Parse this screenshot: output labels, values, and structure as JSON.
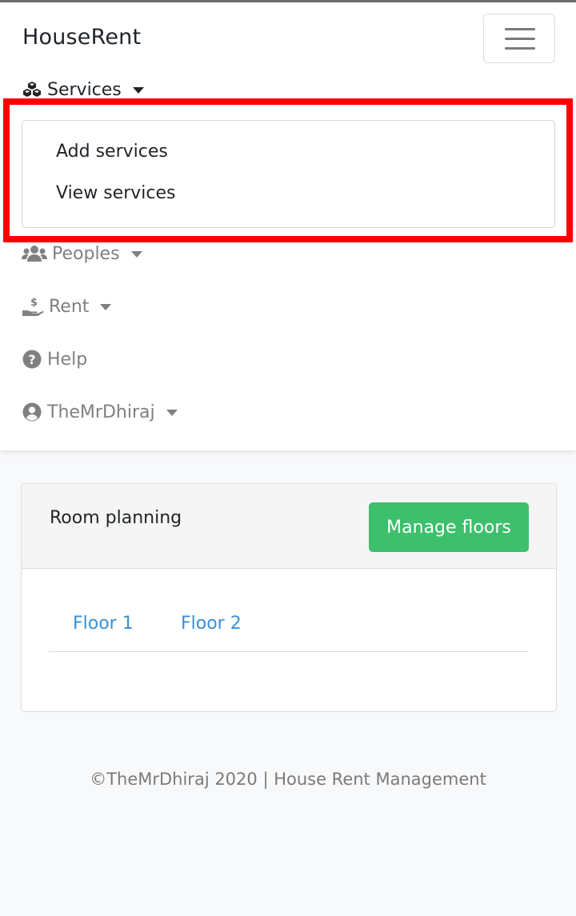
{
  "brand": "HouseRent",
  "nav": {
    "services": {
      "label": "Services",
      "icon": "cubes-icon"
    },
    "dropdown": [
      "Add services",
      "View services"
    ],
    "peoples": {
      "label": "Peoples",
      "icon": "users-icon"
    },
    "rent": {
      "label": "Rent",
      "icon": "hand-dollar-icon"
    },
    "help": {
      "label": "Help",
      "icon": "question-circle-icon"
    },
    "user": {
      "label": "TheMrDhiraj",
      "icon": "user-circle-icon"
    }
  },
  "card": {
    "title": "Room planning",
    "button": "Manage floors",
    "tabs": [
      "Floor 1",
      "Floor 2"
    ]
  },
  "footer": "©TheMrDhiraj 2020 | House Rent Management",
  "colors": {
    "accent_green": "#3dbf6c",
    "link_blue": "#3a8fd6",
    "highlight_red": "#ff0000"
  }
}
